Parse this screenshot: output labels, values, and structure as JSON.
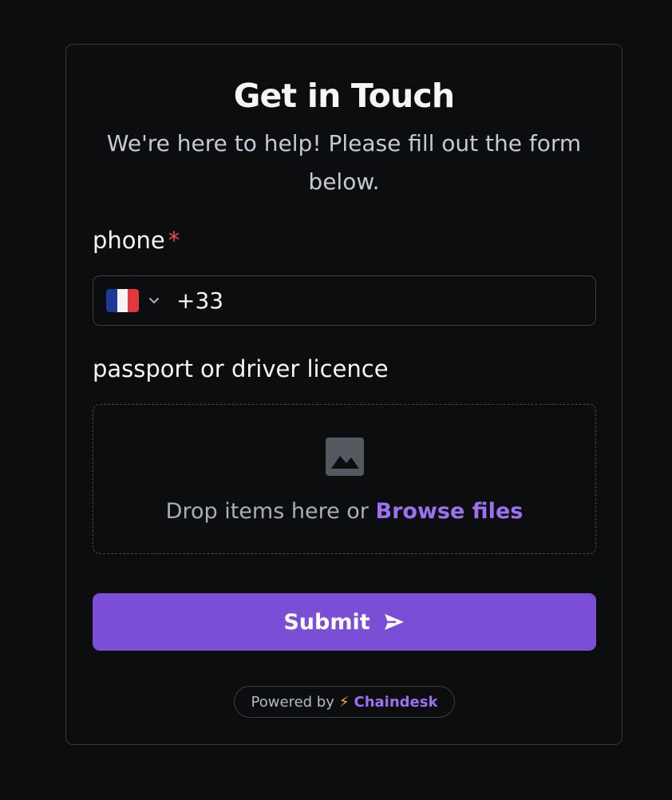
{
  "form": {
    "title": "Get in Touch",
    "subtitle": "We're here to help! Please fill out the form below.",
    "phone_field": {
      "label": "phone",
      "required_mark": "*",
      "country_flag": "france-flag-icon",
      "value": "+33"
    },
    "document_field": {
      "label": "passport or driver licence",
      "drop_text": "Drop items here or",
      "browse_label": "Browse files",
      "icon": "image-icon"
    },
    "submit": {
      "label": "Submit",
      "icon": "send-icon"
    }
  },
  "footer": {
    "powered_prefix": "Powered by",
    "bolt": "⚡",
    "brand": "Chaindesk"
  },
  "colors": {
    "background": "#0c0d0f",
    "accent": "#7a4fd6",
    "link": "#9a72ef",
    "required": "#e05252"
  }
}
